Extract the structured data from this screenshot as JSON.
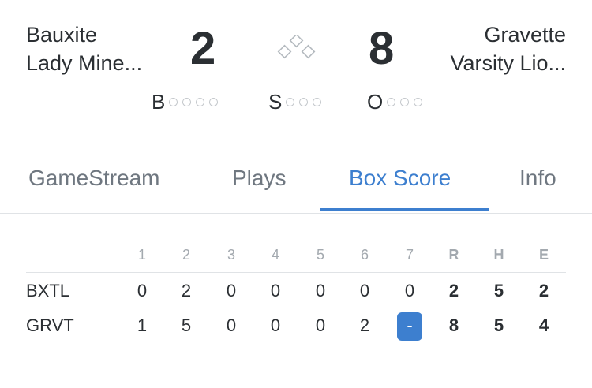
{
  "home_team": {
    "line1": "Bauxite",
    "line2": "Lady Mine...",
    "score": "2"
  },
  "away_team": {
    "line1": "Gravette",
    "line2": "Varsity Lio...",
    "score": "8"
  },
  "count": {
    "balls_label": "B",
    "strikes_label": "S",
    "outs_label": "O",
    "balls": 0,
    "strikes": 0,
    "outs": 0
  },
  "tabs": [
    {
      "label": "GameStream",
      "active": false
    },
    {
      "label": "Plays",
      "active": false
    },
    {
      "label": "Box Score",
      "active": true
    },
    {
      "label": "Info",
      "active": false
    }
  ],
  "box_score": {
    "innings": [
      "1",
      "2",
      "3",
      "4",
      "5",
      "6",
      "7"
    ],
    "totals_headers": [
      "R",
      "H",
      "E"
    ],
    "rows": [
      {
        "team": "BXTL",
        "innings": [
          "0",
          "2",
          "0",
          "0",
          "0",
          "0",
          "0"
        ],
        "totals": [
          "2",
          "5",
          "2"
        ]
      },
      {
        "team": "GRVT",
        "innings": [
          "1",
          "5",
          "0",
          "0",
          "0",
          "2",
          "-"
        ],
        "totals": [
          "8",
          "5",
          "4"
        ]
      }
    ]
  },
  "colors": {
    "accent": "#3d7fcf",
    "text": "#2b2f33",
    "muted": "#6f7780",
    "dot": "#c4c8cc"
  }
}
